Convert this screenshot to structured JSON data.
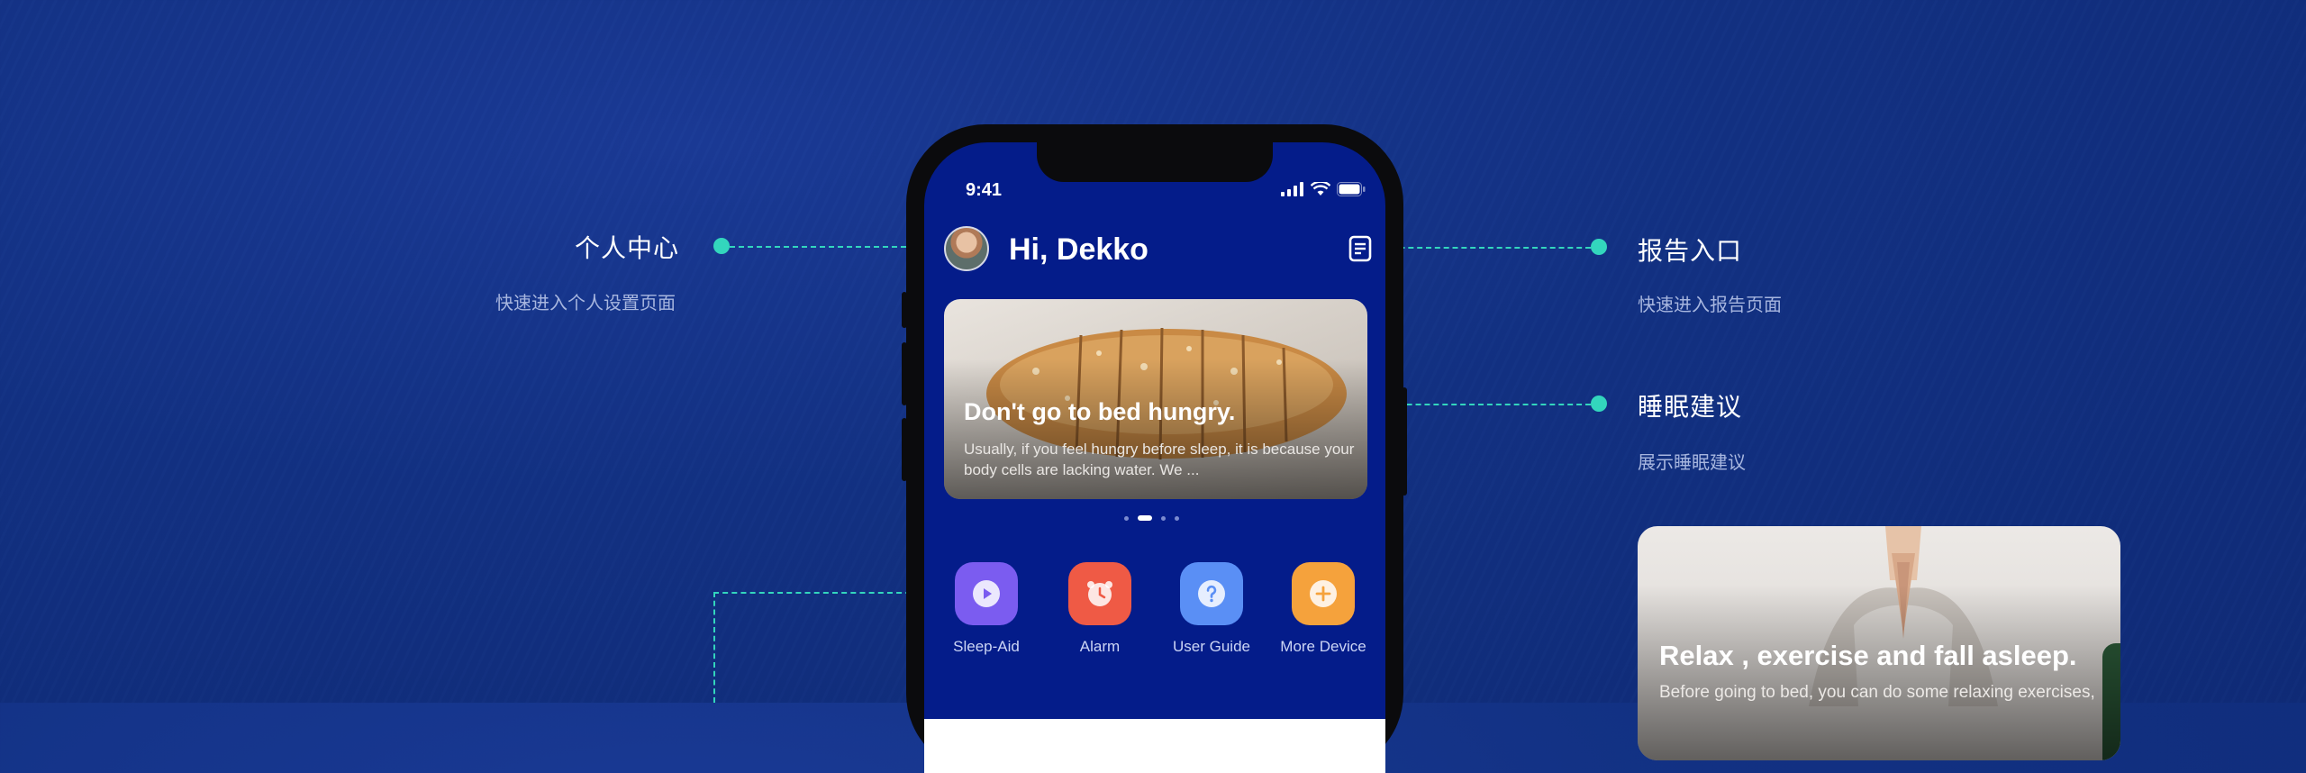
{
  "annotations": {
    "profile": {
      "title": "个人中心",
      "subtitle": "快速进入个人设置页面"
    },
    "report": {
      "title": "报告入口",
      "subtitle": "快速进入报告页面"
    },
    "sleep_advice": {
      "title": "睡眠建议",
      "subtitle": "展示睡眠建议"
    }
  },
  "status_bar": {
    "time": "9:41"
  },
  "header": {
    "greeting": "Hi, Dekko"
  },
  "banner": {
    "title": "Don't go to bed hungry.",
    "description": "Usually, if you feel hungry before sleep, it is because your body cells are lacking water. We ..."
  },
  "carousel": {
    "count": 4,
    "active_index": 1
  },
  "features": [
    {
      "label": "Sleep-Aid",
      "icon": "play-icon",
      "color": "#7b5cf0"
    },
    {
      "label": "Alarm",
      "icon": "alarm-clock-icon",
      "color": "#ef5a45"
    },
    {
      "label": "User Guide",
      "icon": "question-icon",
      "color": "#5a8ff5"
    },
    {
      "label": "More Device",
      "icon": "plus-icon",
      "color": "#f5a23c"
    }
  ],
  "advice_card": {
    "title": "Relax , exercise and fall asleep.",
    "description": "Before going to bed, you can do some relaxing exercises,"
  },
  "colors": {
    "accent": "#33d6bd",
    "screen_bg": "#041c8a",
    "page_bg": "#123183"
  }
}
